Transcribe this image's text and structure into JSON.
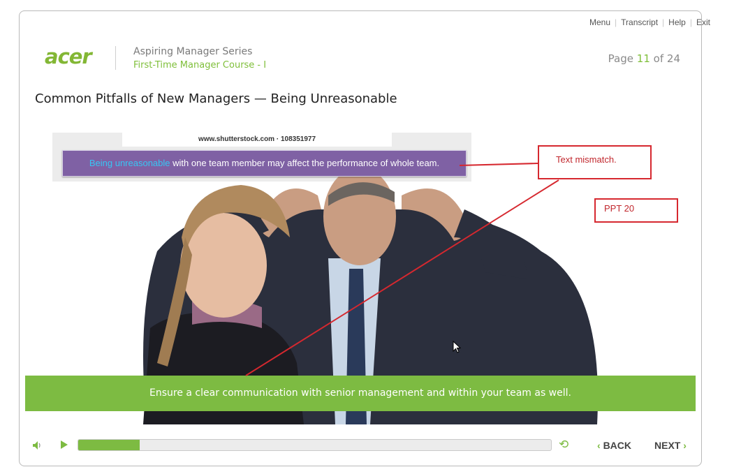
{
  "top_nav": {
    "menu": "Menu",
    "transcript": "Transcript",
    "help": "Help",
    "exit": "Exit"
  },
  "brand": {
    "logo": "acer",
    "series": "Aspiring Manager Series",
    "course": "First-Time Manager Course - I"
  },
  "page": {
    "label": "Page",
    "current": "11",
    "of": "of",
    "total": "24"
  },
  "slide": {
    "title": "Common Pitfalls of New Managers — Being Unreasonable",
    "watermark": "www.shutterstock.com · 108351977",
    "banner_highlight": "Being unreasonable",
    "banner_rest": " with one team member may affect the performance of whole team.",
    "footer_text": "Ensure a clear communication with senior management and within your team as well."
  },
  "annotations": {
    "note1": "Text mismatch.",
    "note2": "PPT 20"
  },
  "player": {
    "back": "BACK",
    "next": "NEXT",
    "progress": 0.13
  },
  "colors": {
    "accent_green": "#7dbb42",
    "banner_purple": "#7f61a4",
    "highlight_cyan": "#38c6f4",
    "annotation_red": "#d6282f"
  },
  "icons": {
    "volume": "speaker-icon",
    "play": "play-icon",
    "replay": "replay-icon",
    "back": "chevron-left-icon",
    "next": "chevron-right-icon"
  }
}
